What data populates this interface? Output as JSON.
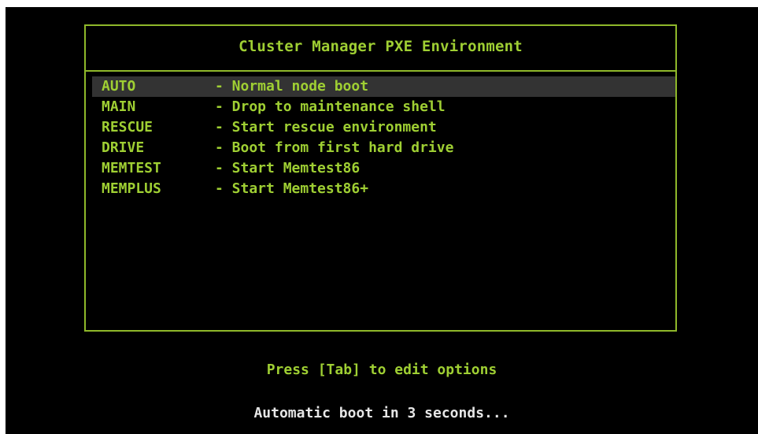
{
  "colors": {
    "background": "#000000",
    "text_green": "#9fcf33",
    "border_green": "#8fb82a",
    "selection_bg": "#333333",
    "text_white": "#e6e6e6"
  },
  "menu": {
    "title": "Cluster Manager PXE Environment",
    "items": [
      {
        "key": "AUTO",
        "description": "- Normal node boot",
        "selected": true
      },
      {
        "key": "MAIN",
        "description": "- Drop to maintenance shell",
        "selected": false
      },
      {
        "key": "RESCUE",
        "description": "- Start rescue environment",
        "selected": false
      },
      {
        "key": "DRIVE",
        "description": "- Boot from first hard drive",
        "selected": false
      },
      {
        "key": "MEMTEST",
        "description": "- Start Memtest86",
        "selected": false
      },
      {
        "key": "MEMPLUS",
        "description": "- Start Memtest86+",
        "selected": false
      }
    ]
  },
  "footer": {
    "hint": "Press [Tab] to edit options",
    "countdown": "Automatic boot in 3 seconds..."
  }
}
